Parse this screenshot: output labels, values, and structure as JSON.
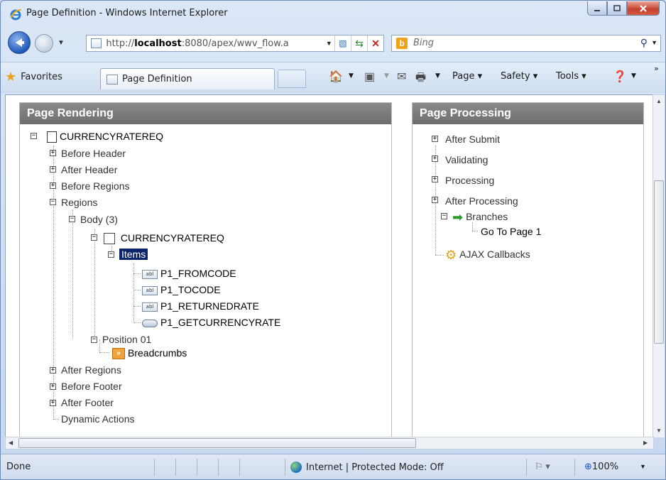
{
  "window": {
    "title": "Page Definition - Windows Internet Explorer"
  },
  "address_bar": {
    "url_prefix": "http://",
    "url_host": "localhost",
    "url_rest": ":8080/apex/wwv_flow.a",
    "search_placeholder": "Bing"
  },
  "favorites_bar": {
    "favorites_label": "Favorites",
    "tab_label": "Page Definition",
    "commands": {
      "page": "Page ▾",
      "safety": "Safety ▾",
      "tools": "Tools ▾"
    }
  },
  "page_rendering": {
    "heading": "Page Rendering",
    "root": "CURRENCYRATEREQ",
    "before_header": "Before Header",
    "after_header": "After Header",
    "before_regions": "Before Regions",
    "regions": "Regions",
    "body": "Body (3)",
    "region_name": "CURRENCYRATEREQ",
    "items_label": "Items",
    "items": [
      "P1_FROMCODE",
      "P1_TOCODE",
      "P1_RETURNEDRATE",
      "P1_GETCURRENCYRATE"
    ],
    "position": "Position 01",
    "breadcrumbs": "Breadcrumbs",
    "after_regions": "After Regions",
    "before_footer": "Before Footer",
    "after_footer": "After Footer",
    "dynamic_actions": "Dynamic Actions"
  },
  "page_processing": {
    "heading": "Page Processing",
    "after_submit": "After Submit",
    "validating": "Validating",
    "processing": "Processing",
    "after_processing": "After Processing",
    "branches": "Branches",
    "go_to_page": "Go To Page 1",
    "ajax_callbacks": "AJAX Callbacks"
  },
  "status_bar": {
    "status": "Done",
    "zone": "Internet | Protected Mode: Off",
    "zoom": "100%"
  }
}
